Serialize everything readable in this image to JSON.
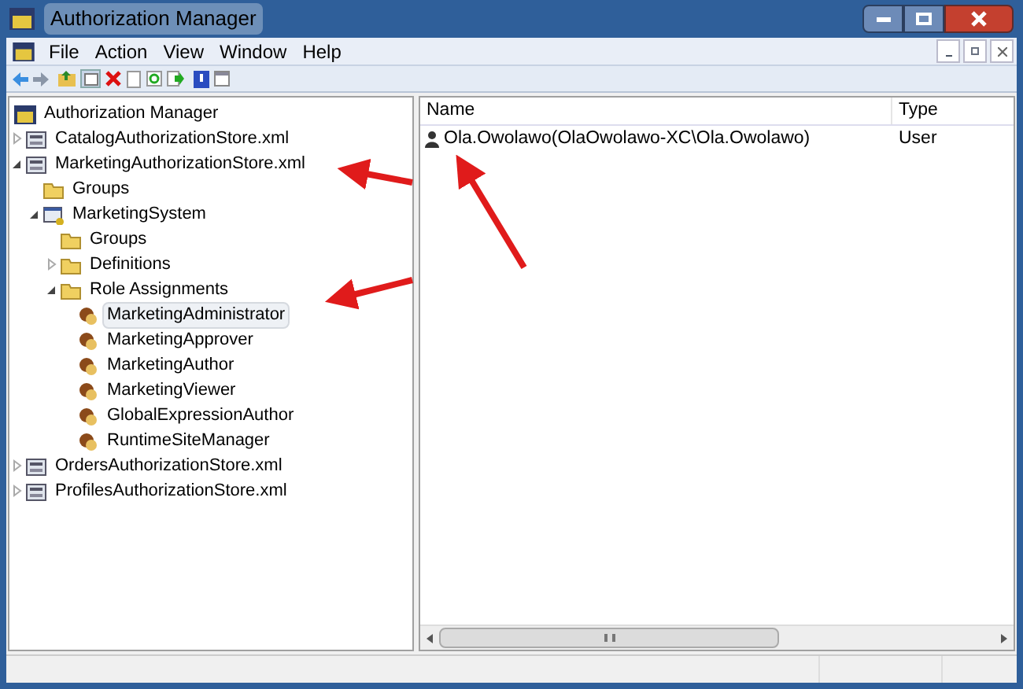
{
  "window": {
    "title": "Authorization Manager"
  },
  "menu": [
    "File",
    "Action",
    "View",
    "Window",
    "Help"
  ],
  "tree": [
    {
      "label": "Authorization Manager",
      "kind": "root",
      "selected": false,
      "children": [
        {
          "label": "CatalogAuthorizationStore.xml",
          "kind": "store",
          "expanded": false,
          "selected": false
        },
        {
          "label": "MarketingAuthorizationStore.xml",
          "kind": "store",
          "expanded": true,
          "selected": false,
          "children": [
            {
              "label": "Groups",
              "kind": "folder",
              "selected": false
            },
            {
              "label": "MarketingSystem",
              "kind": "application",
              "expanded": true,
              "selected": false,
              "children": [
                {
                  "label": "Groups",
                  "kind": "folder",
                  "selected": false
                },
                {
                  "label": "Definitions",
                  "kind": "folder",
                  "expanded": false,
                  "selected": false
                },
                {
                  "label": "Role Assignments",
                  "kind": "folder",
                  "expanded": true,
                  "selected": false,
                  "children": [
                    {
                      "label": "MarketingAdministrator",
                      "kind": "role",
                      "selected": true
                    },
                    {
                      "label": "MarketingApprover",
                      "kind": "role",
                      "selected": false
                    },
                    {
                      "label": "MarketingAuthor",
                      "kind": "role",
                      "selected": false
                    },
                    {
                      "label": "MarketingViewer",
                      "kind": "role",
                      "selected": false
                    },
                    {
                      "label": "GlobalExpressionAuthor",
                      "kind": "role",
                      "selected": false
                    },
                    {
                      "label": "RuntimeSiteManager",
                      "kind": "role",
                      "selected": false
                    }
                  ]
                }
              ]
            }
          ]
        },
        {
          "label": "OrdersAuthorizationStore.xml",
          "kind": "store",
          "expanded": false,
          "selected": false
        },
        {
          "label": "ProfilesAuthorizationStore.xml",
          "kind": "store",
          "expanded": false,
          "selected": false
        }
      ]
    }
  ],
  "list": {
    "columns": [
      "Name",
      "Type"
    ],
    "rows": [
      {
        "name": "Ola.Owolawo(OlaOwolawo-XC\\Ola.Owolawo)",
        "type": "User"
      }
    ]
  }
}
